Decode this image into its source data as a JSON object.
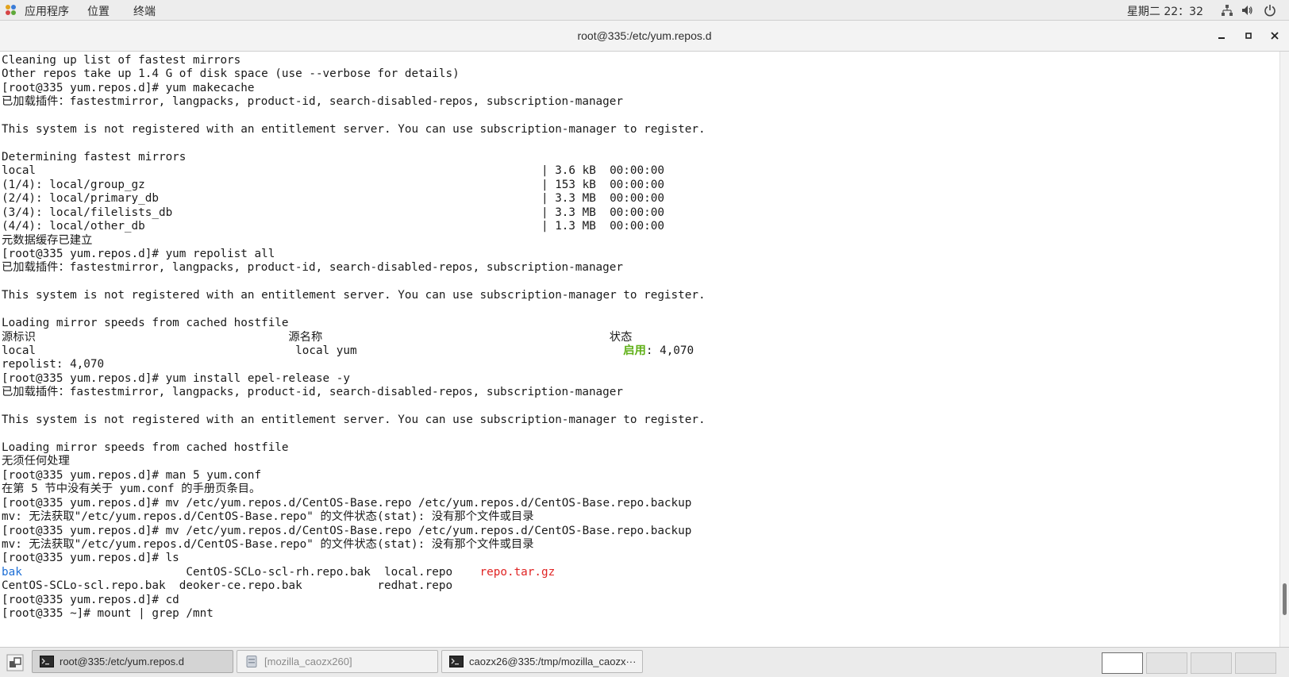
{
  "topbar": {
    "menu": [
      "应用程序",
      "位置",
      "终端"
    ],
    "clock": "星期二 22：32"
  },
  "window": {
    "title": "root@335:/etc/yum.repos.d"
  },
  "terminal": {
    "lines": [
      [
        {
          "t": "Cleaning up list of fastest mirrors"
        }
      ],
      [
        {
          "t": "Other repos take up 1.4 G of disk space (use --verbose for details)"
        }
      ],
      [
        {
          "t": "[root@335 yum.repos.d]# yum makecache"
        }
      ],
      [
        {
          "t": "已加载插件：fastestmirror, langpacks, product-id, search-disabled-repos, subscription-manager"
        }
      ],
      [
        {
          "t": ""
        }
      ],
      [
        {
          "t": "This system is not registered with an entitlement server. You can use subscription-manager to register."
        }
      ],
      [
        {
          "t": ""
        }
      ],
      [
        {
          "t": "Determining fastest mirrors"
        }
      ],
      [
        {
          "t": "local                                                                          | 3.6 kB  00:00:00"
        }
      ],
      [
        {
          "t": "(1/4): local/group_gz                                                          | 153 kB  00:00:00"
        }
      ],
      [
        {
          "t": "(2/4): local/primary_db                                                        | 3.3 MB  00:00:00"
        }
      ],
      [
        {
          "t": "(3/4): local/filelists_db                                                      | 3.3 MB  00:00:00"
        }
      ],
      [
        {
          "t": "(4/4): local/other_db                                                          | 1.3 MB  00:00:00"
        }
      ],
      [
        {
          "t": "元数据缓存已建立"
        }
      ],
      [
        {
          "t": "[root@335 yum.repos.d]# yum repolist all"
        }
      ],
      [
        {
          "t": "已加载插件：fastestmirror, langpacks, product-id, search-disabled-repos, subscription-manager"
        }
      ],
      [
        {
          "t": ""
        }
      ],
      [
        {
          "t": "This system is not registered with an entitlement server. You can use subscription-manager to register."
        }
      ],
      [
        {
          "t": ""
        }
      ],
      [
        {
          "t": "Loading mirror speeds from cached hostfile"
        }
      ],
      [
        {
          "t": "源标识                                     源名称                                          状态"
        }
      ],
      [
        {
          "t": "local                                      local yum                                       "
        },
        {
          "t": "启用",
          "c": "#5fb017",
          "b": true
        },
        {
          "t": ": 4,070"
        }
      ],
      [
        {
          "t": "repolist: 4,070"
        }
      ],
      [
        {
          "t": "[root@335 yum.repos.d]# yum install epel-release -y"
        }
      ],
      [
        {
          "t": "已加载插件：fastestmirror, langpacks, product-id, search-disabled-repos, subscription-manager"
        }
      ],
      [
        {
          "t": ""
        }
      ],
      [
        {
          "t": "This system is not registered with an entitlement server. You can use subscription-manager to register."
        }
      ],
      [
        {
          "t": ""
        }
      ],
      [
        {
          "t": "Loading mirror speeds from cached hostfile"
        }
      ],
      [
        {
          "t": "无须任何处理"
        }
      ],
      [
        {
          "t": "[root@335 yum.repos.d]# man 5 yum.conf"
        }
      ],
      [
        {
          "t": "在第 5 节中没有关于 yum.conf 的手册页条目。"
        }
      ],
      [
        {
          "t": "[root@335 yum.repos.d]# mv /etc/yum.repos.d/CentOS-Base.repo /etc/yum.repos.d/CentOS-Base.repo.backup"
        }
      ],
      [
        {
          "t": "mv: 无法获取\"/etc/yum.repos.d/CentOS-Base.repo\" 的文件状态(stat): 没有那个文件或目录"
        }
      ],
      [
        {
          "t": "[root@335 yum.repos.d]# mv /etc/yum.repos.d/CentOS-Base.repo /etc/yum.repos.d/CentOS-Base.repo.backup"
        }
      ],
      [
        {
          "t": "mv: 无法获取\"/etc/yum.repos.d/CentOS-Base.repo\" 的文件状态(stat): 没有那个文件或目录"
        }
      ],
      [
        {
          "t": "[root@335 yum.repos.d]# ls"
        }
      ],
      [
        {
          "t": "bak",
          "c": "#1e6fd6"
        },
        {
          "t": "                        CentOS-SCLo-scl-rh.repo.bak  local.repo    "
        },
        {
          "t": "repo.tar.gz",
          "c": "#e02424"
        }
      ],
      [
        {
          "t": "CentOS-SCLo-scl.repo.bak  deoker-ce.repo.bak           redhat.repo"
        }
      ],
      [
        {
          "t": "[root@335 yum.repos.d]# cd"
        }
      ],
      [
        {
          "t": "[root@335 ~]# mount | grep /mnt"
        }
      ]
    ]
  },
  "taskbar": {
    "items": [
      {
        "label": "root@335:/etc/yum.repos.d",
        "active": true,
        "dim": false,
        "icon": "terminal-icon"
      },
      {
        "label": "[mozilla_caozx260]",
        "active": false,
        "dim": true,
        "icon": "file-manager-icon"
      },
      {
        "label": "caozx26@335:/tmp/mozilla_caozx···",
        "active": false,
        "dim": false,
        "icon": "terminal-icon"
      }
    ],
    "workspaces": 4,
    "current_workspace": 1
  }
}
